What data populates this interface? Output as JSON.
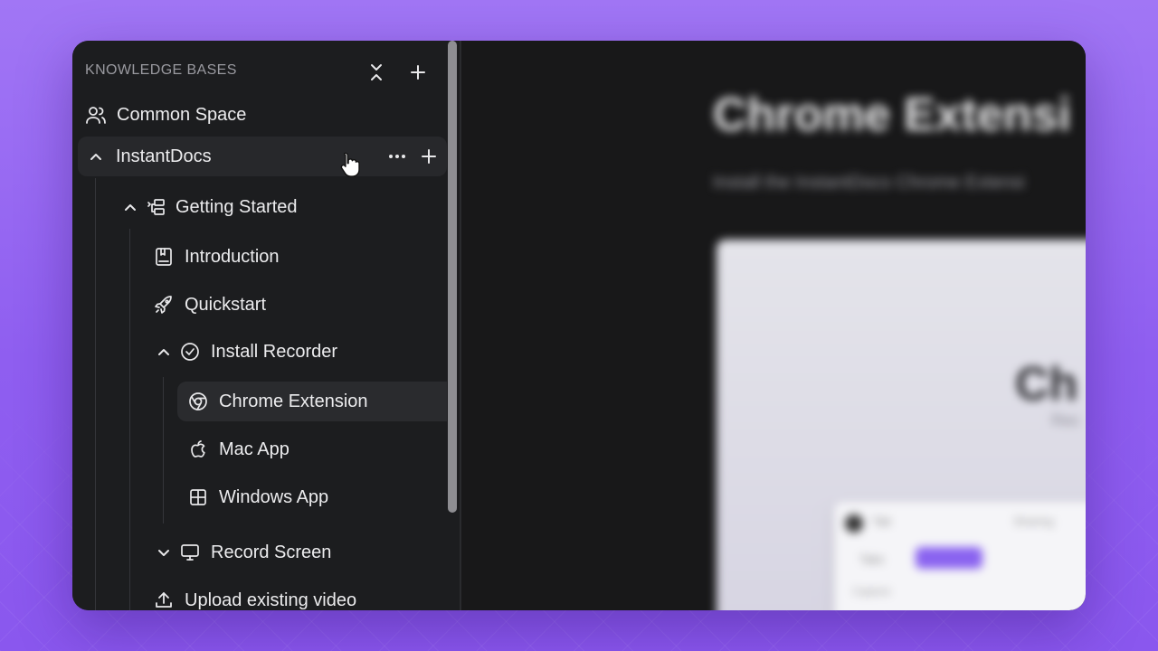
{
  "sidebar": {
    "header": "KNOWLEDGE BASES",
    "common_space": "Common Space",
    "kb": {
      "label": "InstantDocs"
    },
    "items": {
      "getting_started": "Getting Started",
      "introduction": "Introduction",
      "quickstart": "Quickstart",
      "install_recorder": "Install Recorder",
      "chrome_extension": "Chrome Extension",
      "mac_app": "Mac App",
      "windows_app": "Windows App",
      "record_screen": "Record Screen",
      "upload_video": "Upload existing video"
    }
  },
  "content": {
    "title": "Chrome Extensi",
    "subtitle": "Install the InstantDocs Chrome Extensi",
    "preview_title": "Ch",
    "preview_sub": "Rec",
    "mini": {
      "t1": "Tab",
      "t2": "Sharing",
      "t3": "Tabs",
      "t4": "Capture"
    }
  },
  "colors": {
    "background": "#9a6cf3",
    "panel": "#1c1d1f",
    "accent": "#8a63f0"
  },
  "icons": [
    "collapse-all-icon",
    "plus-icon",
    "users-icon",
    "chevron-up-icon",
    "more-icon",
    "folder-tree-icon",
    "book-icon",
    "rocket-icon",
    "check-circle-icon",
    "chrome-icon",
    "apple-icon",
    "windows-icon",
    "chevron-down-icon",
    "monitor-icon",
    "upload-icon",
    "hand-cursor-icon"
  ]
}
